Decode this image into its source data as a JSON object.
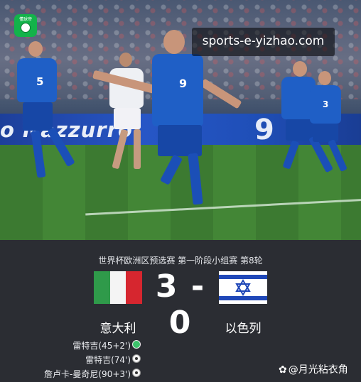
{
  "watermark": {
    "url": "sports-e-yizhao.com",
    "logo_text": "懂球帝",
    "author": "@月光粘衣角"
  },
  "photo": {
    "ad_board_text": "o Nazzurro",
    "ad_board_number": "9",
    "shirt_numbers": [
      "5",
      "9",
      "3"
    ]
  },
  "match": {
    "competition": "世界杯欧洲区预选赛 第一阶段小组赛 第8轮",
    "score": "3 - 0",
    "home_team": "意大利",
    "away_team": "以色列",
    "scorers": [
      {
        "text": "雷特吉(45+2')",
        "icon": "penalty-icon"
      },
      {
        "text": "雷特吉(74')",
        "icon": "ball-icon"
      },
      {
        "text": "詹卢卡-曼奇尼(90+3')",
        "icon": "ball-icon"
      }
    ]
  },
  "colors": {
    "card_bg": "#2b2d33",
    "italy_green": "#2f9a4a",
    "italy_red": "#d6262f",
    "israel_blue": "#1f47b8",
    "italy_kit": "#1f5fc6"
  }
}
